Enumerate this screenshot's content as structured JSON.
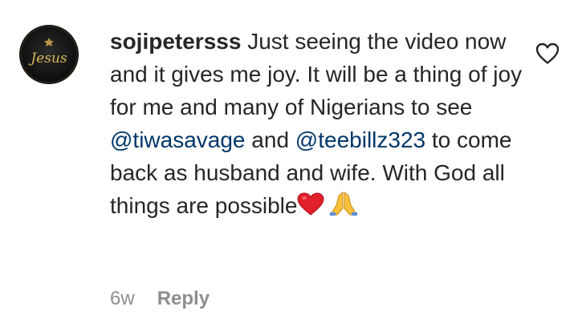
{
  "comment": {
    "avatar_text": "Jesus",
    "username": "sojipetersss",
    "text_part1": "Just seeing the video now and it gives me joy. It will be a thing of joy for me and many of Nigerians to see ",
    "mention1": "@tiwasavage",
    "text_part2": " and ",
    "mention2": "@teebillz323",
    "text_part3": " to come back as husband and wife. With God all things are possible",
    "emoji1": "red-heart",
    "emoji2": "folded-hands",
    "time": "6w",
    "reply_label": "Reply",
    "like_icon": "heart-outline-icon"
  },
  "colors": {
    "text": "#262626",
    "mention": "#00376b",
    "meta": "#8e8e8e"
  }
}
